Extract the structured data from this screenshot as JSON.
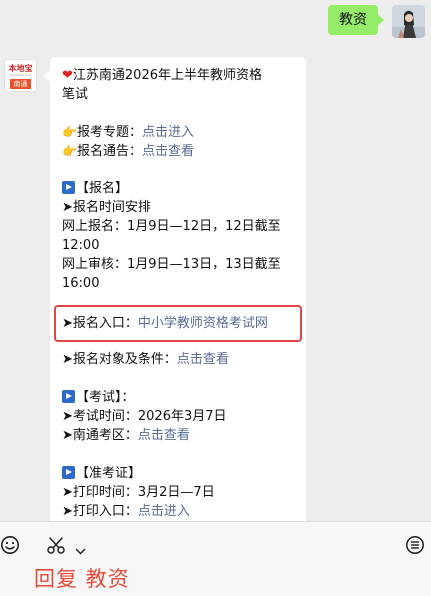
{
  "outgoing": {
    "text": "教资"
  },
  "bot": {
    "logo_top": "本地宝",
    "logo_mid": "bendibao.com",
    "logo_bottom": "南通"
  },
  "article": {
    "title_l1": "江苏南通2026年上半年教师资格",
    "title_l2": "笔试",
    "topic_label": "报考专题：",
    "topic_link": "点击进入",
    "notice_label": "报名通告：",
    "notice_link": "点击查看",
    "sec_register": "【报名】",
    "reg_time_head": "➤报名时间安排",
    "online_reg_l1": "网上报名：1月9日—12日，12日截至",
    "online_reg_l2": "12:00",
    "online_review_l1": "网上审核：1月9日—13日，13日截至",
    "online_review_l2": "16:00",
    "entry_label": "➤报名入口：",
    "entry_link": "中小学教师资格考试网",
    "target_label": "➤报名对象及条件：",
    "target_link": "点击查看",
    "sec_exam": "【考试】：",
    "exam_time": "➤考试时间：2026年3月7日",
    "exam_area_label": "➤南通考区：",
    "exam_area_link": "点击查看",
    "sec_admit": "【准考证】",
    "print_time": "➤打印时间：3月2日—7日",
    "print_entry_label": "➤打印入口：",
    "print_entry_link": "点击进入"
  },
  "bottom": {
    "reply_text": "回复 教资"
  },
  "icons": {
    "emoji": "emoji-icon",
    "scissors": "scissors-icon",
    "menu": "menu-list-icon"
  },
  "colors": {
    "link": "#576b95",
    "outgoing_bubble": "#95ec69",
    "highlight_box": "#e04646",
    "reply_text": "#e64b3c"
  }
}
